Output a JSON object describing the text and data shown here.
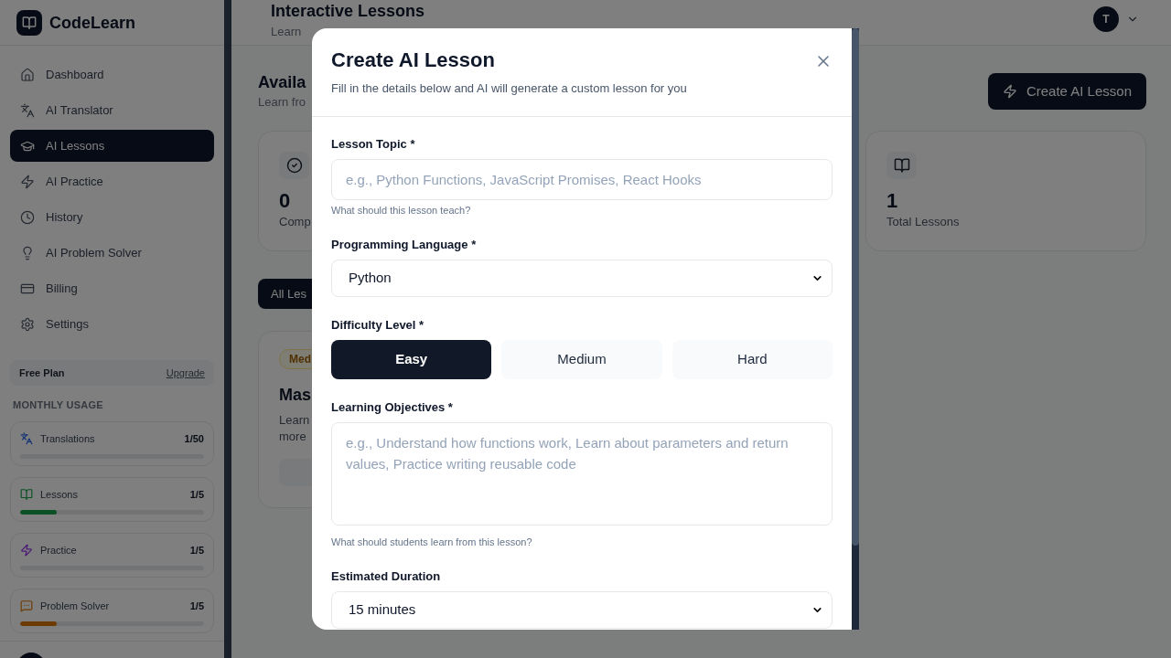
{
  "sidebar": {
    "brand": "CodeLearn",
    "nav": [
      {
        "label": "Dashboard",
        "selected": false
      },
      {
        "label": "AI Translator",
        "selected": false
      },
      {
        "label": "AI Lessons",
        "selected": true
      },
      {
        "label": "AI Practice",
        "selected": false
      },
      {
        "label": "History",
        "selected": false
      },
      {
        "label": "AI Problem Solver",
        "selected": false
      },
      {
        "label": "Billing",
        "selected": false
      },
      {
        "label": "Settings",
        "selected": false
      }
    ],
    "plan": {
      "name": "Free Plan",
      "link": "Upgrade"
    },
    "usage_title": "MONTHLY USAGE",
    "usage": [
      {
        "label": "Translations",
        "count": "1/50"
      },
      {
        "label": "Lessons",
        "count": "1/5",
        "level": 0.2
      },
      {
        "label": "Practice",
        "count": "1/5"
      },
      {
        "label": "Problem Solver",
        "count": "1/5",
        "level": 0.2
      }
    ]
  },
  "header": {
    "title": "Interactive Lessons",
    "subtitle": "Learn",
    "user_initial": "T"
  },
  "lessons_section": {
    "title": "Availa",
    "subtitle": "Learn fro",
    "create_button": "Create AI Lesson"
  },
  "stats": [
    {
      "value": "0",
      "label": "Comp"
    },
    {
      "value": "1",
      "label": "Total Lessons"
    }
  ],
  "filters": [
    {
      "label": "All Les",
      "selected": true
    }
  ],
  "lesson_card": {
    "badge": "Med",
    "title": "Mas",
    "description_lines": [
      "Learn",
      "more"
    ]
  },
  "modal": {
    "title": "Create AI Lesson",
    "subtitle": "Fill in the details below and AI will generate a custom lesson for you",
    "fields": [
      {
        "kind": "text",
        "label": "Lesson Topic *",
        "placeholder": "e.g., Python Functions, JavaScript Promises, React Hooks",
        "hint": "What should this lesson teach?"
      },
      {
        "kind": "select",
        "label": "Programming Language *",
        "value": "Python"
      },
      {
        "kind": "choice",
        "label": "Difficulty Level *",
        "options": [
          {
            "label": "Easy",
            "selected": true
          },
          {
            "label": "Medium",
            "selected": false
          },
          {
            "label": "Hard",
            "selected": false
          }
        ]
      },
      {
        "kind": "textarea",
        "label": "Learning Objectives *",
        "placeholder": "e.g., Understand how functions work, Learn about parameters and return values, Practice writing reusable code",
        "hint": "What should students learn from this lesson?"
      },
      {
        "kind": "select",
        "label": "Estimated Duration",
        "value": "15 minutes"
      }
    ]
  }
}
